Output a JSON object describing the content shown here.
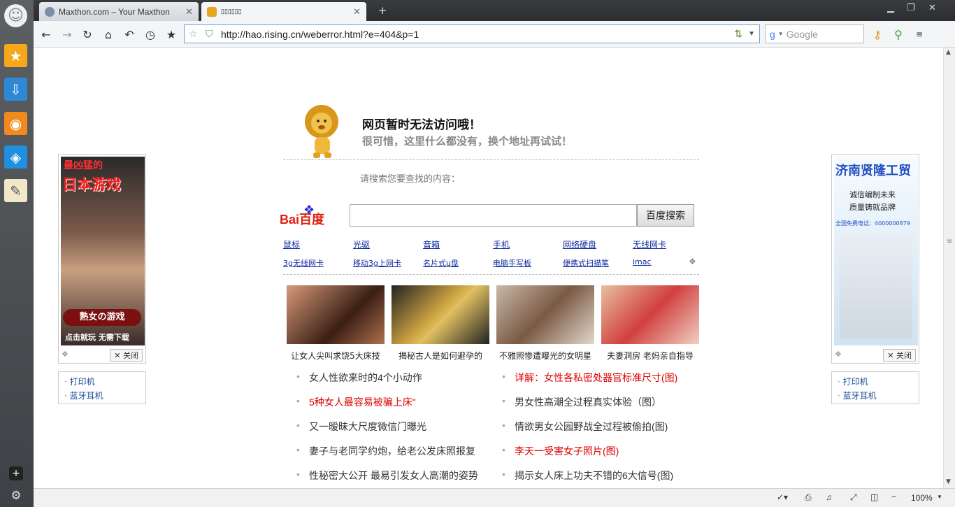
{
  "browser": {
    "tabs": [
      {
        "label": "Maxthon.com – Your Maxthon",
        "icon": "maxthon-icon"
      },
      {
        "label": "▯▯▯▯▯▯",
        "icon": "lion-favicon-icon"
      }
    ],
    "address": "http://hao.rising.cn/weberror.html?e=404&p=1",
    "search_placeholder": "Google",
    "zoom": "100%"
  },
  "page": {
    "error_title": "网页暂时无法访问哦！",
    "error_subtitle": "很可惜，这里什么都没有，换个地址再试试！",
    "search_hint": "请搜索您要查找的内容：",
    "baidu_button": "百度搜索",
    "baidu_logo_text": "Bai百度",
    "keywords_row1": [
      "鼠标",
      "光驱",
      "音箱",
      "手机",
      "网络硬盘",
      "无线网卡"
    ],
    "keywords_row2": [
      "3g无线网卡",
      "移动3g上网卡",
      "名片式u盘",
      "电脑手写板",
      "便携式扫描笔",
      "imac"
    ],
    "thumbs": [
      {
        "caption": "让女人尖叫求饶5大床技"
      },
      {
        "caption": "揭秘古人是如何避孕的"
      },
      {
        "caption": "不雅照惨遭曝光的女明星"
      },
      {
        "caption": "夫妻洞房 老妈亲自指导"
      }
    ],
    "news_left": [
      {
        "text": "女人性欲来时的4个小动作",
        "red": false
      },
      {
        "text": "5种女人最容易被骗上床\"",
        "red": true
      },
      {
        "text": "又一暧昧大尺度微信门曝光",
        "red": false
      },
      {
        "text": "妻子与老同学约炮，给老公发床照报复",
        "red": false
      },
      {
        "text": "性秘密大公开 最易引发女人高潮的姿势",
        "red": false
      }
    ],
    "news_right": [
      {
        "text": "详解：女性各私密处器官标准尺寸(图)",
        "red": true
      },
      {
        "text": "男女性高潮全过程真实体验（图）",
        "red": false
      },
      {
        "text": "情欲男女公园野战全过程被偷拍(图)",
        "red": false
      },
      {
        "text": "李天一受害女子照片(图)",
        "red": true
      },
      {
        "text": "揭示女人床上功夫不错的6大信号(图)",
        "red": false
      }
    ]
  },
  "ads": {
    "left": {
      "line1": "最凶猛的",
      "line2": "日本游戏",
      "badge": "熟女の游戏",
      "bottom": "点击就玩 无需下载",
      "close": "✕ 关闭",
      "links": [
        "打印机",
        "蓝牙耳机"
      ]
    },
    "right": {
      "title": "济南贤隆工贸",
      "line1": "诚信编制未来",
      "line2": "质量铸就品牌",
      "phone": "全国免费电话：4000000879",
      "close": "✕ 关闭",
      "links": [
        "打印机",
        "蓝牙耳机"
      ]
    }
  }
}
